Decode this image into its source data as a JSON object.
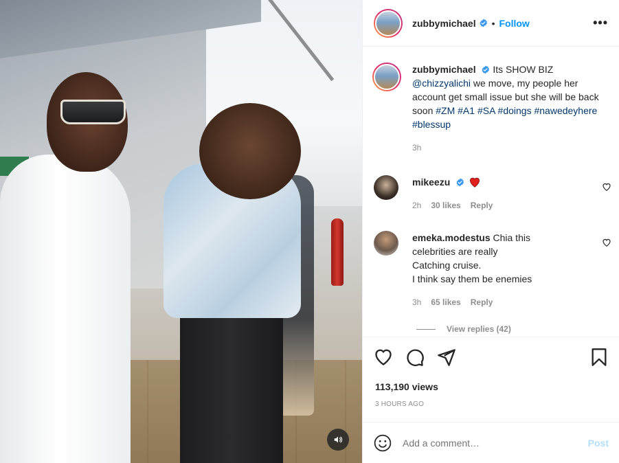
{
  "post": {
    "author": "zubbymichael",
    "follow_label": "Follow",
    "separator": "•",
    "more_label": "•••",
    "caption_start": "Its SHOW BIZ ",
    "caption_mention": "@chizzyalichi",
    "caption_middle": " we move, my people her account get small issue but she will be back soon ",
    "caption_tags": [
      "#ZM",
      "#A1",
      "#SA",
      "#doings",
      "#nawedeyhere",
      "#blessup"
    ],
    "caption_age": "3h"
  },
  "comments": [
    {
      "username": "mikeezu",
      "text": "",
      "emoji": "heart",
      "age": "2h",
      "likes": "30 likes",
      "reply_label": "Reply"
    },
    {
      "username": "emeka.modestus",
      "text": "Chia this celebrities are really Catching cruise. I think say them be enemies",
      "lines": [
        "Chia this",
        "celebrities are really",
        "Catching cruise.",
        "I think say them be enemies"
      ],
      "age": "3h",
      "likes": "65 likes",
      "reply_label": "Reply"
    }
  ],
  "view_replies": "View replies (42)",
  "stats": {
    "views": "113,190 views",
    "posted": "3 HOURS AGO"
  },
  "comment_box": {
    "placeholder": "Add a comment…",
    "post_label": "Post"
  },
  "colors": {
    "accent": "#0095f6",
    "link": "#00376b",
    "muted": "#8e8e8e",
    "heart_red": "#ed4956",
    "post_disabled": "#b2dffc"
  }
}
